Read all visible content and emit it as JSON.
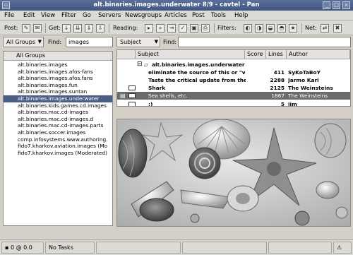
{
  "window": {
    "title": "alt.binaries.images.underwater 8/9 - cavtel - Pan"
  },
  "menu": [
    "File",
    "Edit",
    "View",
    "Filter",
    "Go",
    "Servers",
    "Newsgroups",
    "Articles",
    "Post",
    "Tools",
    "Help"
  ],
  "toolbar": {
    "post_label": "Post:",
    "get_label": "Get:",
    "reading_label": "Reading:",
    "filters_label": "Filters:",
    "net_label": "Net:"
  },
  "groups": {
    "filter_select": "All Groups",
    "find_label": "Find:",
    "find_value": "images",
    "column_header": "All Groups",
    "items": [
      "alt.binaries.images",
      "alt.binaries.images.afos-fans",
      "alt.binaries.images.afos.fans",
      "alt.binaries.images.fun",
      "alt.binaries.images.suntan",
      "alt.binaries.images.underwater",
      "alt.binaries.kids.games.cd.images",
      "alt.binaries.mac.cd-images",
      "alt.binaries.mac.cd-images.d",
      "alt.binaries.mac.cd-images.parts",
      "alt.binaries.soccer.images",
      "comp.infosystems.www.authoring.",
      "fido7.kharkov.aviation.images (Mo",
      "fido7.kharkov.images (Moderated)"
    ],
    "selected_index": 5
  },
  "headers": {
    "filter_select": "Subject",
    "find_label": "Find:",
    "find_value": "",
    "columns": {
      "subject": "Subject",
      "score": "Score",
      "lines": "Lines",
      "author": "Author"
    },
    "group_row": "alt.binaries.images.underwater",
    "rows": [
      {
        "subject": "eliminate the source of this or \"v",
        "lines": "411",
        "author": "SyKoTaBoY",
        "selected": false
      },
      {
        "subject": "Taste the critical update from the",
        "lines": "2288",
        "author": "Jarmo Kari",
        "selected": false
      },
      {
        "subject": "Shark",
        "lines": "2125",
        "author": "The Weinsteins",
        "selected": false
      },
      {
        "subject": "Sea shells, etc.",
        "lines": "1867",
        "author": "The Weinsteins",
        "selected": true
      },
      {
        "subject": ":)",
        "lines": "5",
        "author": "jim",
        "selected": false
      }
    ]
  },
  "status": {
    "speed": "0 @ 0.0 KB/s",
    "tasks": "No Tasks"
  }
}
